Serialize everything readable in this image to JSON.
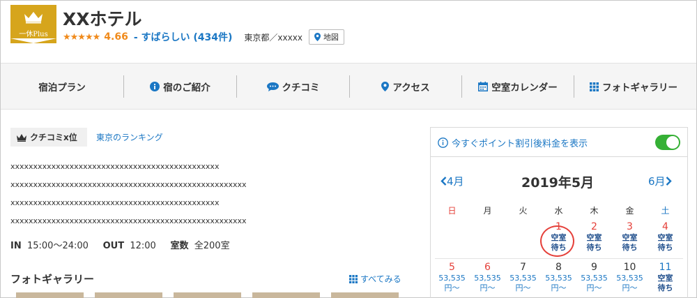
{
  "header": {
    "logo_text": "一休Plus",
    "hotel_name": "XXホテル",
    "stars": "★★★★★",
    "score": "4.66",
    "verdict": "- すばらしい (434件)",
    "address": "東京都／xxxxx",
    "map_button": "地図"
  },
  "nav": {
    "items": [
      "宿泊プラン",
      "宿のご紹介",
      "クチコミ",
      "アクセス",
      "空室カレンダー",
      "フォトギャラリー"
    ]
  },
  "main": {
    "ranking_badge": "クチコミx位",
    "ranking_link": "東京のランキング",
    "description": [
      "xxxxxxxxxxxxxxxxxxxxxxxxxxxxxxxxxxxxxxxxxxxxxx",
      "xxxxxxxxxxxxxxxxxxxxxxxxxxxxxxxxxxxxxxxxxxxxxxxxxxxx",
      "xxxxxxxxxxxxxxxxxxxxxxxxxxxxxxxxxxxxxxxxxxxxxx",
      "xxxxxxxxxxxxxxxxxxxxxxxxxxxxxxxxxxxxxxxxxxxxxxxxxxxx"
    ],
    "checkin_label": "IN",
    "checkin_value": "15:00〜24:00",
    "checkout_label": "OUT",
    "checkout_value": "12:00",
    "rooms_label": "室数",
    "rooms_value": "全200室",
    "gallery_title": "フォトギャラリー",
    "see_all": "すべてみる"
  },
  "calendar": {
    "points_text": "今すぐポイント割引後料金を表示",
    "points_toggle_on": true,
    "prev": "4月",
    "title": "2019年5月",
    "next": "6月",
    "weekdays": [
      "日",
      "月",
      "火",
      "水",
      "木",
      "金",
      "土"
    ],
    "week1": [
      {
        "day": "1",
        "status_l1": "空室",
        "status_l2": "待ち"
      },
      {
        "day": "2",
        "status_l1": "空室",
        "status_l2": "待ち"
      },
      {
        "day": "3",
        "status_l1": "空室",
        "status_l2": "待ち"
      },
      {
        "day": "4",
        "status_l1": "空室",
        "status_l2": "待ち"
      }
    ],
    "week2": [
      {
        "day": "5",
        "price": "53,535",
        "suffix": "円〜"
      },
      {
        "day": "6",
        "price": "53,535",
        "suffix": "円〜"
      },
      {
        "day": "7",
        "price": "53,535",
        "suffix": "円〜"
      },
      {
        "day": "8",
        "price": "53,535",
        "suffix": "円〜"
      },
      {
        "day": "9",
        "price": "53,535",
        "suffix": "円〜"
      },
      {
        "day": "10",
        "price": "53,535",
        "suffix": "円〜"
      },
      {
        "day": "11",
        "status_l1": "空室",
        "status_l2": "待ち"
      }
    ],
    "colors": {
      "holiday": "#e5403a",
      "saturday": "#1b77c4",
      "accent": "#1b77c4",
      "toggle": "#35b035"
    }
  }
}
